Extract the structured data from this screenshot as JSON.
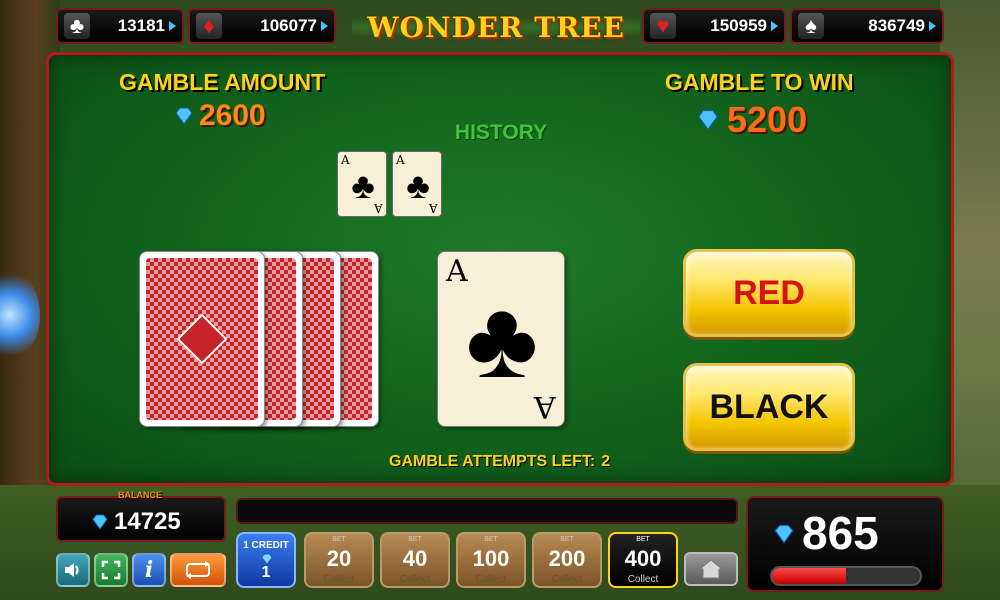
{
  "top_bar": {
    "suits": [
      {
        "icon": "club-icon",
        "symbol": "♣",
        "value": "13181"
      },
      {
        "icon": "diamond-suit-icon",
        "symbol": "♦",
        "value": "106077"
      },
      {
        "icon": "heart-icon",
        "symbol": "♥",
        "value": "150959"
      },
      {
        "icon": "spade-icon",
        "symbol": "♠",
        "value": "836749"
      }
    ],
    "logo_text": "WONDER TREE"
  },
  "gamble": {
    "amount_label": "GAMBLE AMOUNT",
    "amount_value": "2600",
    "to_win_label": "GAMBLE TO WIN",
    "to_win_value": "5200",
    "history_label": "HISTORY",
    "history_cards": [
      {
        "rank": "A",
        "suit": "♣"
      },
      {
        "rank": "A",
        "suit": "♣"
      }
    ],
    "current_card": {
      "rank": "A",
      "suit": "♣"
    },
    "red_button": "RED",
    "black_button": "BLACK",
    "attempts_label": "GAMBLE ATTEMPTS LEFT:",
    "attempts_value": "2"
  },
  "bottom_bar": {
    "balance_label": "BALANCE",
    "balance_value": "14725",
    "win_value": "865",
    "win_progress": 0.5,
    "credit_label": "1 CREDIT",
    "credit_value": "1",
    "bet_small_label": "BET",
    "collect_label": "Collect",
    "bets": [
      "20",
      "40",
      "100",
      "200",
      "400"
    ],
    "active_bet": "400"
  },
  "colors": {
    "felt": "#11621c",
    "border": "#b41818",
    "label_yellow": "#ffd21a",
    "value_orange": "#ff8a1a",
    "history_green": "#3fc43a",
    "diamond_blue": "#4fc3ff"
  }
}
